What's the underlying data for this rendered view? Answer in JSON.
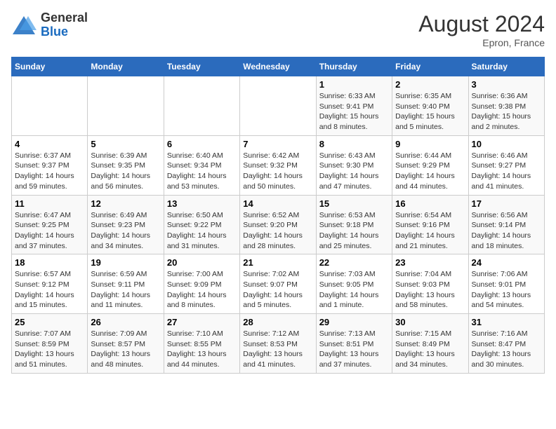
{
  "header": {
    "logo_general": "General",
    "logo_blue": "Blue",
    "month_title": "August 2024",
    "location": "Epron, France"
  },
  "days_of_week": [
    "Sunday",
    "Monday",
    "Tuesday",
    "Wednesday",
    "Thursday",
    "Friday",
    "Saturday"
  ],
  "weeks": [
    [
      {
        "day": "",
        "info": ""
      },
      {
        "day": "",
        "info": ""
      },
      {
        "day": "",
        "info": ""
      },
      {
        "day": "",
        "info": ""
      },
      {
        "day": "1",
        "info": "Sunrise: 6:33 AM\nSunset: 9:41 PM\nDaylight: 15 hours\nand 8 minutes."
      },
      {
        "day": "2",
        "info": "Sunrise: 6:35 AM\nSunset: 9:40 PM\nDaylight: 15 hours\nand 5 minutes."
      },
      {
        "day": "3",
        "info": "Sunrise: 6:36 AM\nSunset: 9:38 PM\nDaylight: 15 hours\nand 2 minutes."
      }
    ],
    [
      {
        "day": "4",
        "info": "Sunrise: 6:37 AM\nSunset: 9:37 PM\nDaylight: 14 hours\nand 59 minutes."
      },
      {
        "day": "5",
        "info": "Sunrise: 6:39 AM\nSunset: 9:35 PM\nDaylight: 14 hours\nand 56 minutes."
      },
      {
        "day": "6",
        "info": "Sunrise: 6:40 AM\nSunset: 9:34 PM\nDaylight: 14 hours\nand 53 minutes."
      },
      {
        "day": "7",
        "info": "Sunrise: 6:42 AM\nSunset: 9:32 PM\nDaylight: 14 hours\nand 50 minutes."
      },
      {
        "day": "8",
        "info": "Sunrise: 6:43 AM\nSunset: 9:30 PM\nDaylight: 14 hours\nand 47 minutes."
      },
      {
        "day": "9",
        "info": "Sunrise: 6:44 AM\nSunset: 9:29 PM\nDaylight: 14 hours\nand 44 minutes."
      },
      {
        "day": "10",
        "info": "Sunrise: 6:46 AM\nSunset: 9:27 PM\nDaylight: 14 hours\nand 41 minutes."
      }
    ],
    [
      {
        "day": "11",
        "info": "Sunrise: 6:47 AM\nSunset: 9:25 PM\nDaylight: 14 hours\nand 37 minutes."
      },
      {
        "day": "12",
        "info": "Sunrise: 6:49 AM\nSunset: 9:23 PM\nDaylight: 14 hours\nand 34 minutes."
      },
      {
        "day": "13",
        "info": "Sunrise: 6:50 AM\nSunset: 9:22 PM\nDaylight: 14 hours\nand 31 minutes."
      },
      {
        "day": "14",
        "info": "Sunrise: 6:52 AM\nSunset: 9:20 PM\nDaylight: 14 hours\nand 28 minutes."
      },
      {
        "day": "15",
        "info": "Sunrise: 6:53 AM\nSunset: 9:18 PM\nDaylight: 14 hours\nand 25 minutes."
      },
      {
        "day": "16",
        "info": "Sunrise: 6:54 AM\nSunset: 9:16 PM\nDaylight: 14 hours\nand 21 minutes."
      },
      {
        "day": "17",
        "info": "Sunrise: 6:56 AM\nSunset: 9:14 PM\nDaylight: 14 hours\nand 18 minutes."
      }
    ],
    [
      {
        "day": "18",
        "info": "Sunrise: 6:57 AM\nSunset: 9:12 PM\nDaylight: 14 hours\nand 15 minutes."
      },
      {
        "day": "19",
        "info": "Sunrise: 6:59 AM\nSunset: 9:11 PM\nDaylight: 14 hours\nand 11 minutes."
      },
      {
        "day": "20",
        "info": "Sunrise: 7:00 AM\nSunset: 9:09 PM\nDaylight: 14 hours\nand 8 minutes."
      },
      {
        "day": "21",
        "info": "Sunrise: 7:02 AM\nSunset: 9:07 PM\nDaylight: 14 hours\nand 5 minutes."
      },
      {
        "day": "22",
        "info": "Sunrise: 7:03 AM\nSunset: 9:05 PM\nDaylight: 14 hours\nand 1 minute."
      },
      {
        "day": "23",
        "info": "Sunrise: 7:04 AM\nSunset: 9:03 PM\nDaylight: 13 hours\nand 58 minutes."
      },
      {
        "day": "24",
        "info": "Sunrise: 7:06 AM\nSunset: 9:01 PM\nDaylight: 13 hours\nand 54 minutes."
      }
    ],
    [
      {
        "day": "25",
        "info": "Sunrise: 7:07 AM\nSunset: 8:59 PM\nDaylight: 13 hours\nand 51 minutes."
      },
      {
        "day": "26",
        "info": "Sunrise: 7:09 AM\nSunset: 8:57 PM\nDaylight: 13 hours\nand 48 minutes."
      },
      {
        "day": "27",
        "info": "Sunrise: 7:10 AM\nSunset: 8:55 PM\nDaylight: 13 hours\nand 44 minutes."
      },
      {
        "day": "28",
        "info": "Sunrise: 7:12 AM\nSunset: 8:53 PM\nDaylight: 13 hours\nand 41 minutes."
      },
      {
        "day": "29",
        "info": "Sunrise: 7:13 AM\nSunset: 8:51 PM\nDaylight: 13 hours\nand 37 minutes."
      },
      {
        "day": "30",
        "info": "Sunrise: 7:15 AM\nSunset: 8:49 PM\nDaylight: 13 hours\nand 34 minutes."
      },
      {
        "day": "31",
        "info": "Sunrise: 7:16 AM\nSunset: 8:47 PM\nDaylight: 13 hours\nand 30 minutes."
      }
    ]
  ]
}
